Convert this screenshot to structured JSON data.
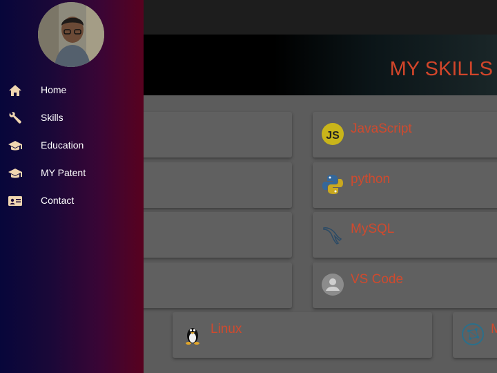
{
  "header": {
    "title": "MY SKILLS"
  },
  "drawer": {
    "avatar_icon": "profile-photo",
    "items": [
      {
        "label": "Home",
        "icon": "home-icon"
      },
      {
        "label": "Skills",
        "icon": "wrench-icon"
      },
      {
        "label": "Education",
        "icon": "graduation-cap-icon"
      },
      {
        "label": "MY Patent",
        "icon": "graduation-cap-icon"
      },
      {
        "label": "Contact",
        "icon": "contact-card-icon"
      }
    ]
  },
  "skills": [
    {
      "label": "JavaScript",
      "icon": "javascript-icon"
    },
    {
      "label": "python",
      "icon": "python-icon"
    },
    {
      "label": "MySQL",
      "icon": "mysql-dolphin-icon"
    },
    {
      "label": "VS Code",
      "icon": "person-avatar-icon"
    },
    {
      "label": "Linux",
      "icon": "linux-penguin-icon"
    },
    {
      "label": "M",
      "icon": "network-globe-icon"
    }
  ],
  "colors": {
    "accent": "#d1452a",
    "drawer_start": "#07063a",
    "drawer_end": "#58021f",
    "icon_tint": "#f0d6b0"
  }
}
